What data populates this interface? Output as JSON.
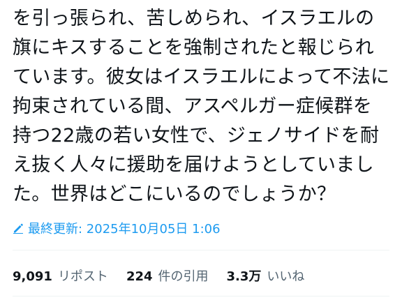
{
  "post": {
    "lines": [
      "を引っ張られ、苦しめられ、イスラエルの",
      "旗にキスすることを強制されたと報じられ",
      "ています。彼女はイスラエルによって不法に",
      "拘束されている間、アスペルガー症候群を",
      "持つ22歳の若い女性で、ジェノサイドを耐",
      "え抜く人々に援助を届けようとしていまし",
      "た。世界はどこにいるのでしょうか？"
    ],
    "edited_label": "最終更新: 2025年10月05日 1:06"
  },
  "stats": {
    "reposts_count": "9,091",
    "reposts_label": "リポスト",
    "quotes_count": "224",
    "quotes_label": "件の引用",
    "likes_count": "3.3万",
    "likes_label": "いいね"
  },
  "colors": {
    "text": "#0f1419",
    "accent": "#1d9bf0",
    "muted": "#536471",
    "divider": "#eff3f4"
  },
  "icons": {
    "edited": "pencil-icon"
  }
}
